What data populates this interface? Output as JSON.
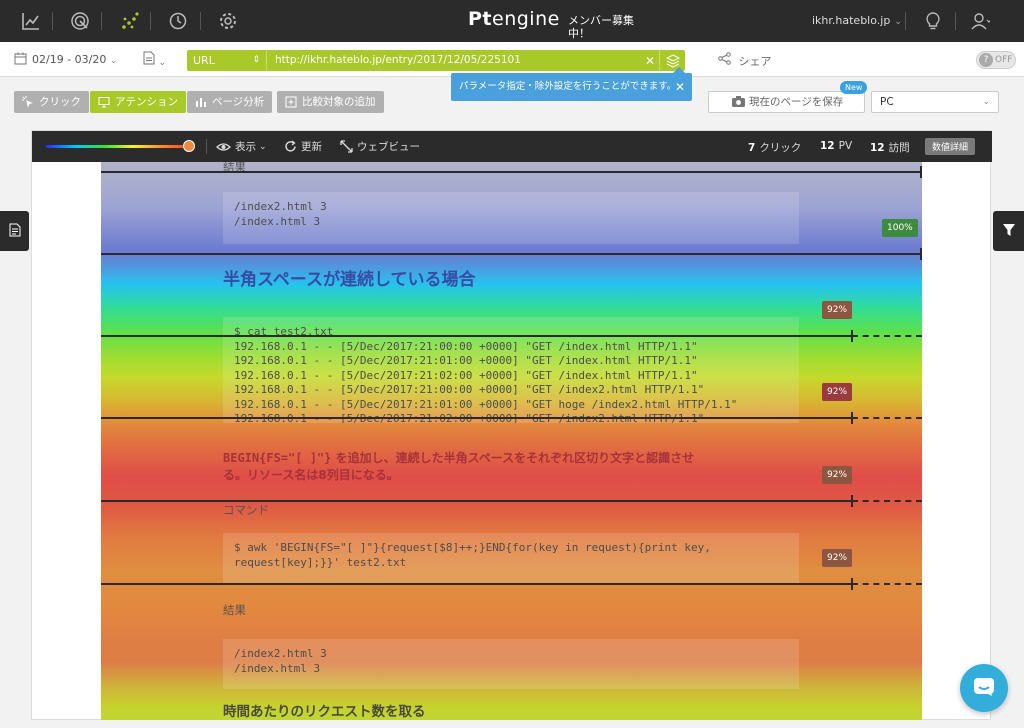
{
  "topnav": {
    "logo_prefix": "Pt",
    "logo_suffix": "engine",
    "recruit_line1": "メンバー募集",
    "recruit_line2": "中！",
    "account": "ikhr.hateblo.jp",
    "icons": [
      "line-chart-icon",
      "target-icon",
      "dots-icon",
      "clock-icon",
      "gear-icon",
      "lightbulb-icon",
      "user-icon"
    ]
  },
  "toolbar": {
    "date_range": "02/19 - 03/20",
    "url_type": "URL",
    "url_value": "http://ikhr.hateblo.jp/entry/2017/12/05/225101",
    "share_label": "シェア",
    "toggle_label": "OFF"
  },
  "tooltip": {
    "text": "パラメータ指定・除外設定を行うことができます。"
  },
  "modes": {
    "click": "クリック",
    "attention": "アテンション",
    "page_analysis": "ページ分析",
    "compare": "比較対象の追加",
    "active": "attention"
  },
  "save": {
    "label": "現在のページを保存",
    "badge": "New"
  },
  "device": {
    "selected": "PC"
  },
  "heatmap_bar": {
    "view_label": "表示",
    "refresh_label": "更新",
    "webview_label": "ウェブビュー",
    "clicks_value": "7",
    "clicks_label": "クリック",
    "pv_value": "12",
    "pv_label": "PV",
    "visits_value": "12",
    "visits_label": "訪問",
    "detail_button": "数値詳細"
  },
  "content": {
    "result_label_1": "結果",
    "code_block_1": [
      "/index2.html 3",
      "/index.html 3"
    ],
    "heading_1": "半角スペースが連続している場合",
    "code_block_2": [
      "$ cat test2.txt",
      "192.168.0.1 - - [5/Dec/2017:21:00:00 +0000] \"GET  /index.html HTTP/1.1\"",
      "192.168.0.1 - - [5/Dec/2017:21:01:00 +0000] \"GET  /index.html HTTP/1.1\"",
      "192.168.0.1 - - [5/Dec/2017:21:02:00 +0000] \"GET  /index.html HTTP/1.1\"",
      "192.168.0.1 - - [5/Dec/2017:21:00:00 +0000] \"GET  /index2.html HTTP/1.1\"",
      "192.168.0.1 - - [5/Dec/2017:21:01:00 +0000] \"GET hoge /index2.html HTTP/1.1\"",
      "192.168.0.1 - - [5/Dec/2017:21:02:00 +0000] \"GET  /index2.html HTTP/1.1\""
    ],
    "para_code": "BEGIN{FS=\"[ ]\"}",
    "para_line1": "を追加し、連続した半角スペースをそれぞれ区切り文字と認識させ",
    "para_line2": "る。リソース名は8列目になる。",
    "command_label": "コマンド",
    "code_block_3": [
      "$ awk 'BEGIN{FS=\"[ ]\"}{request[$8]++;}END{for(key in request){print key,",
      "request[key];}}' test2.txt"
    ],
    "result_label_2": "結果",
    "code_block_4": [
      "/index2.html 3",
      "/index.html 3"
    ],
    "heading_2": "時間あたりのリクエスト数を取る"
  },
  "fold_lines": [
    {
      "percent": "100%",
      "reach": 1.0
    },
    {
      "percent": "100%",
      "reach": 1.0
    },
    {
      "percent": "92%",
      "reach": 0.92
    },
    {
      "percent": "92%",
      "reach": 0.92
    },
    {
      "percent": "92%",
      "reach": 0.92
    },
    {
      "percent": "92%",
      "reach": 0.92
    }
  ],
  "colors": {
    "accent_green": "#a9c82a",
    "tooltip_blue": "#4aa0dc",
    "dark_bar": "#2b2b2b",
    "chat_blue": "#33aedb"
  }
}
